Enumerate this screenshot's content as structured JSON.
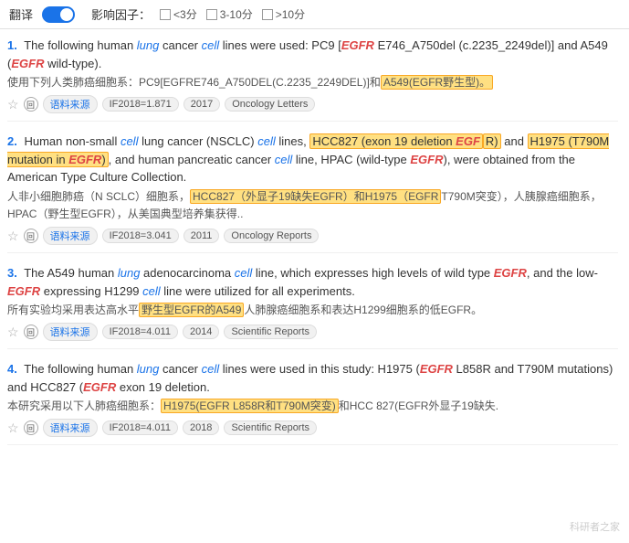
{
  "topbar": {
    "translate_label": "翻译",
    "toggle_state": "on",
    "filter_label": "影响因子：",
    "filters": [
      {
        "id": "lt3",
        "label": "<3分"
      },
      {
        "id": "3to10",
        "label": "3-10分"
      },
      {
        "id": "gt10",
        "label": ">10分"
      }
    ]
  },
  "results": [
    {
      "num": "1.",
      "text_parts": [
        {
          "type": "text",
          "content": "The following human "
        },
        {
          "type": "italic_blue",
          "content": "lung"
        },
        {
          "type": "text",
          "content": " cancer "
        },
        {
          "type": "italic_blue",
          "content": "cell"
        },
        {
          "type": "text",
          "content": " lines were used: PC9 ["
        },
        {
          "type": "italic_red",
          "content": "EGFR"
        },
        {
          "type": "text",
          "content": " E746_A750del (c.2235_2249del)] and A549 ("
        },
        {
          "type": "italic_red",
          "content": "EGFR"
        },
        {
          "type": "text",
          "content": " wild-type)."
        }
      ],
      "chinese_before": "使用下列人类肺癌细胞系：PC9[EGFRE746_A750DEL(C.2235_2249DEL)]和",
      "chinese_highlight": "A549(EGFR野生型)。",
      "chinese_after": "",
      "meta": {
        "source": "语料来源",
        "if": "IF2018=1.871",
        "year": "2017",
        "journal": "Oncology Letters"
      }
    },
    {
      "num": "2.",
      "text_parts": [
        {
          "type": "text",
          "content": "Human non-small "
        },
        {
          "type": "italic_blue",
          "content": "cell"
        },
        {
          "type": "text",
          "content": " lung cancer (NSCLC) "
        },
        {
          "type": "italic_blue",
          "content": "cell"
        },
        {
          "type": "text",
          "content": " lines, "
        },
        {
          "type": "highlight",
          "content": "HCC827 (exon 19 deletion EGF"
        },
        {
          "type": "text_continued_highlight",
          "content": "R)"
        },
        {
          "type": "text",
          "content": " and "
        },
        {
          "type": "highlight2",
          "content": "H1975 (T790M mutation in "
        },
        {
          "type": "italic_red_in_highlight",
          "content": "EGFR"
        },
        {
          "type": "text",
          "content": ")"
        },
        {
          "type": "text",
          "content": ", and human pancreatic cancer "
        },
        {
          "type": "italic_blue",
          "content": "cell"
        },
        {
          "type": "text",
          "content": " line, HPAC (wild-type "
        },
        {
          "type": "italic_red",
          "content": "EGFR"
        },
        {
          "type": "text",
          "content": "), were obtained from the American Type Culture Collection."
        }
      ],
      "chinese_before": "人非小细胞肺癌（N SCLC）细胞系，",
      "chinese_highlight": "HCC827（外显子19缺失EGFR）和H1975（EGFR",
      "chinese_after": "T790M突变），人胰腺癌细胞系，HPAC（野生型EGFR），从美国典型培养集获得..",
      "meta": {
        "source": "语料来源",
        "if": "IF2018=3.041",
        "year": "2011",
        "journal": "Oncology Reports"
      }
    },
    {
      "num": "3.",
      "text_parts": [
        {
          "type": "text",
          "content": "The A549 human "
        },
        {
          "type": "italic_blue",
          "content": "lung"
        },
        {
          "type": "text",
          "content": " adenocarcinoma "
        },
        {
          "type": "italic_blue",
          "content": "cell"
        },
        {
          "type": "text",
          "content": " line, which expresses high levels of wild type "
        },
        {
          "type": "italic_red",
          "content": "EGFR"
        },
        {
          "type": "text",
          "content": ", and the low-"
        },
        {
          "type": "italic_red",
          "content": "EGFR"
        },
        {
          "type": "text",
          "content": " expressing H1299 "
        },
        {
          "type": "italic_blue",
          "content": "cell"
        },
        {
          "type": "text",
          "content": " line were utilized for all experiments."
        }
      ],
      "chinese_before": "所有实验均采用表达高水平",
      "chinese_highlight": "野生型EGFR的A549",
      "chinese_after": "人肺腺癌细胞系和表达H1299细胞系的低EGFR。",
      "meta": {
        "source": "语料来源",
        "if": "IF2018=4.011",
        "year": "2014",
        "journal": "Scientific Reports"
      }
    },
    {
      "num": "4.",
      "text_parts": [
        {
          "type": "text",
          "content": "The following human "
        },
        {
          "type": "italic_blue",
          "content": "lung"
        },
        {
          "type": "text",
          "content": " cancer "
        },
        {
          "type": "italic_blue",
          "content": "cell"
        },
        {
          "type": "text",
          "content": " lines were used in this study: H1975 ("
        },
        {
          "type": "italic_red",
          "content": "EGFR"
        },
        {
          "type": "text",
          "content": " L858R and T790M mutations) and HCC827 ("
        },
        {
          "type": "italic_red",
          "content": "EGFR"
        },
        {
          "type": "text",
          "content": " exon 19 deletion."
        }
      ],
      "chinese_before": "本研究采用以下人肺癌细胞系：",
      "chinese_highlight": "H1975(EGFR L858R和T790M突变)",
      "chinese_after": "和HCC 827(EGFR外显子19缺失.",
      "meta": {
        "source": "语料来源",
        "if": "IF2018=4.011",
        "year": "2018",
        "journal": "Scientific Reports"
      }
    }
  ],
  "watermark": "科研者之家"
}
